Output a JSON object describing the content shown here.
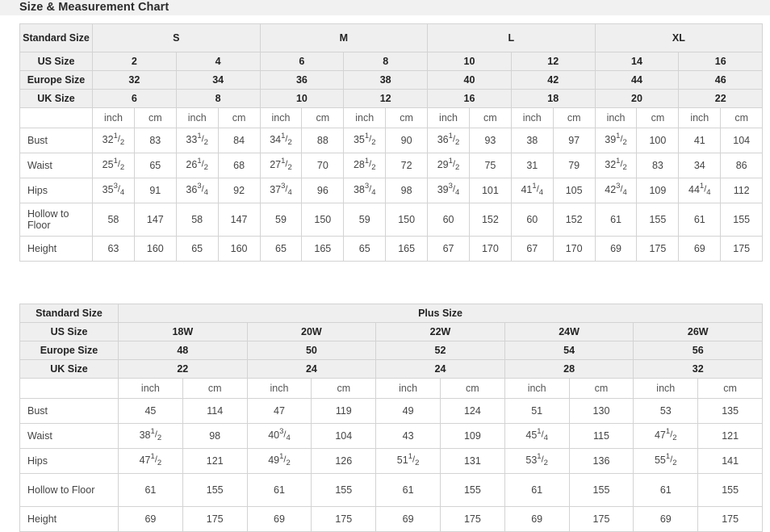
{
  "header": {
    "title": "Size & Measurement Chart"
  },
  "colors": {
    "header_bg": "#efefef",
    "title_bg": "#f1f1f1",
    "border": "#d3d3d3",
    "text": "#444444",
    "heading_text": "#222222"
  },
  "standard_table": {
    "row_label_header": "Standard Size",
    "groups": [
      {
        "label": "S",
        "span": 4
      },
      {
        "label": "M",
        "span": 4
      },
      {
        "label": "L",
        "span": 4
      },
      {
        "label": "XL",
        "span": 4
      }
    ],
    "size_rows": [
      {
        "label": "US Size",
        "values": [
          "2",
          "4",
          "6",
          "8",
          "10",
          "12",
          "14",
          "16"
        ]
      },
      {
        "label": "Europe Size",
        "values": [
          "32",
          "34",
          "36",
          "38",
          "40",
          "42",
          "44",
          "46"
        ]
      },
      {
        "label": "UK Size",
        "values": [
          "6",
          "8",
          "10",
          "12",
          "16",
          "18",
          "20",
          "22"
        ]
      }
    ],
    "unit_row": {
      "label": "",
      "units": [
        "inch",
        "cm",
        "inch",
        "cm",
        "inch",
        "cm",
        "inch",
        "cm",
        "inch",
        "cm",
        "inch",
        "cm",
        "inch",
        "cm",
        "inch",
        "cm"
      ]
    },
    "measurement_rows": [
      {
        "label": "Bust",
        "values": [
          "32 1/2",
          "83",
          "33 1/2",
          "84",
          "34 1/2",
          "88",
          "35 1/2",
          "90",
          "36 1/2",
          "93",
          "38",
          "97",
          "39 1/2",
          "100",
          "41",
          "104"
        ]
      },
      {
        "label": "Waist",
        "values": [
          "25 1/2",
          "65",
          "26 1/2",
          "68",
          "27 1/2",
          "70",
          "28 1/2",
          "72",
          "29 1/2",
          "75",
          "31",
          "79",
          "32 1/2",
          "83",
          "34",
          "86"
        ]
      },
      {
        "label": "Hips",
        "values": [
          "35 3/4",
          "91",
          "36 3/4",
          "92",
          "37 3/4",
          "96",
          "38 3/4",
          "98",
          "39 3/4",
          "101",
          "41 1/4",
          "105",
          "42 3/4",
          "109",
          "44 1/4",
          "112"
        ]
      },
      {
        "label": "Hollow to Floor",
        "values": [
          "58",
          "147",
          "58",
          "147",
          "59",
          "150",
          "59",
          "150",
          "60",
          "152",
          "60",
          "152",
          "61",
          "155",
          "61",
          "155"
        ]
      },
      {
        "label": "Height",
        "values": [
          "63",
          "160",
          "65",
          "160",
          "65",
          "165",
          "65",
          "165",
          "67",
          "170",
          "67",
          "170",
          "69",
          "175",
          "69",
          "175"
        ]
      }
    ]
  },
  "plus_table": {
    "row_label_header": "Standard Size",
    "group_label": "Plus Size",
    "size_rows": [
      {
        "label": "US Size",
        "values": [
          "18W",
          "20W",
          "22W",
          "24W",
          "26W"
        ]
      },
      {
        "label": "Europe Size",
        "values": [
          "48",
          "50",
          "52",
          "54",
          "56"
        ]
      },
      {
        "label": "UK Size",
        "values": [
          "22",
          "24",
          "24",
          "28",
          "32"
        ]
      }
    ],
    "unit_row": {
      "label": "",
      "units": [
        "inch",
        "cm",
        "inch",
        "cm",
        "inch",
        "cm",
        "inch",
        "cm",
        "inch",
        "cm"
      ]
    },
    "measurement_rows": [
      {
        "label": "Bust",
        "values": [
          "45",
          "114",
          "47",
          "119",
          "49",
          "124",
          "51",
          "130",
          "53",
          "135"
        ]
      },
      {
        "label": "Waist",
        "values": [
          "38 1/2",
          "98",
          "40 3/4",
          "104",
          "43",
          "109",
          "45 1/4",
          "115",
          "47 1/2",
          "121"
        ]
      },
      {
        "label": "Hips",
        "values": [
          "47 1/2",
          "121",
          "49 1/2",
          "126",
          "51 1/2",
          "131",
          "53 1/2",
          "136",
          "55 1/2",
          "141"
        ]
      },
      {
        "label": "Hollow to Floor",
        "values": [
          "61",
          "155",
          "61",
          "155",
          "61",
          "155",
          "61",
          "155",
          "61",
          "155"
        ]
      },
      {
        "label": "Height",
        "values": [
          "69",
          "175",
          "69",
          "175",
          "69",
          "175",
          "69",
          "175",
          "69",
          "175"
        ]
      }
    ]
  }
}
